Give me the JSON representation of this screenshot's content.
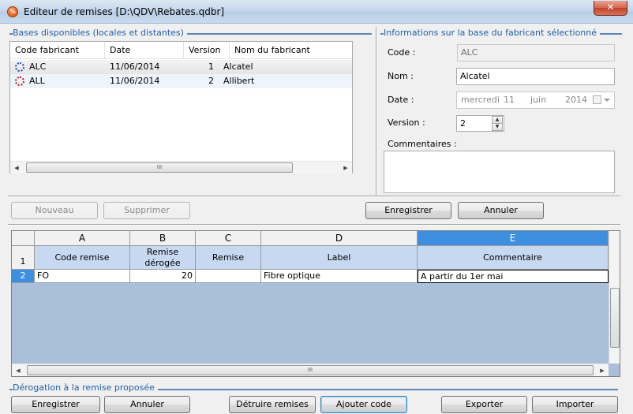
{
  "window": {
    "title": "Editeur de remises [D:\\QDV\\Rebates.qdbr]",
    "close_glyph": "✕",
    "icon_glyph": "%"
  },
  "bases": {
    "group_title": "Bases disponibles (locales et distantes)",
    "columns": [
      "Code fabricant",
      "Date",
      "Version",
      "Nom du fabricant"
    ],
    "rows": [
      {
        "code": "ALC",
        "date": "11/06/2014",
        "version": "1",
        "name": "Alcatel",
        "icon": "gear-blue-icon",
        "icon_color": "#1f4fbf"
      },
      {
        "code": "ALL",
        "date": "11/06/2014",
        "version": "2",
        "name": "Allibert",
        "icon": "gear-red-icon",
        "icon_color": "#c81818"
      }
    ],
    "scroll_left": "◀",
    "scroll_right": "▶",
    "thumb_grip": "III"
  },
  "info": {
    "group_title": "Informations sur la base du fabricant sélectionné",
    "code_label": "Code :",
    "code_value": "ALC",
    "nom_label": "Nom :",
    "nom_value": "Alcatel",
    "date_label": "Date :",
    "date_weekday": "mercredi",
    "date_day": "11",
    "date_month": "juin",
    "date_year": "2014",
    "version_label": "Version :",
    "version_value": "2",
    "comments_label": "Commentaires :",
    "comments_value": ""
  },
  "toolbar": {
    "nouveau": "Nouveau",
    "supprimer": "Supprimer",
    "enregistrer": "Enregistrer",
    "annuler": "Annuler"
  },
  "grid": {
    "col_letters": [
      "A",
      "B",
      "C",
      "D",
      "E"
    ],
    "row_numbers": [
      "1",
      "2"
    ],
    "headers": [
      "Code remise",
      "Remise\ndérogée",
      "Remise",
      "Label",
      "Commentaire"
    ],
    "rows": [
      [
        "FO",
        "20",
        "",
        "Fibre optique",
        "A partir du 1er mai"
      ]
    ],
    "active_column": "E",
    "active_row": "2",
    "active_color": "#3f8fe0",
    "background_color": "#aabfd9"
  },
  "derogation": {
    "group_title": "Dérogation à la remise proposée"
  },
  "bottom": {
    "enregistrer": "Enregistrer",
    "annuler": "Annuler",
    "detruire": "Détruire remises",
    "ajouter": "Ajouter code",
    "exporter": "Exporter",
    "importer": "Importer"
  }
}
